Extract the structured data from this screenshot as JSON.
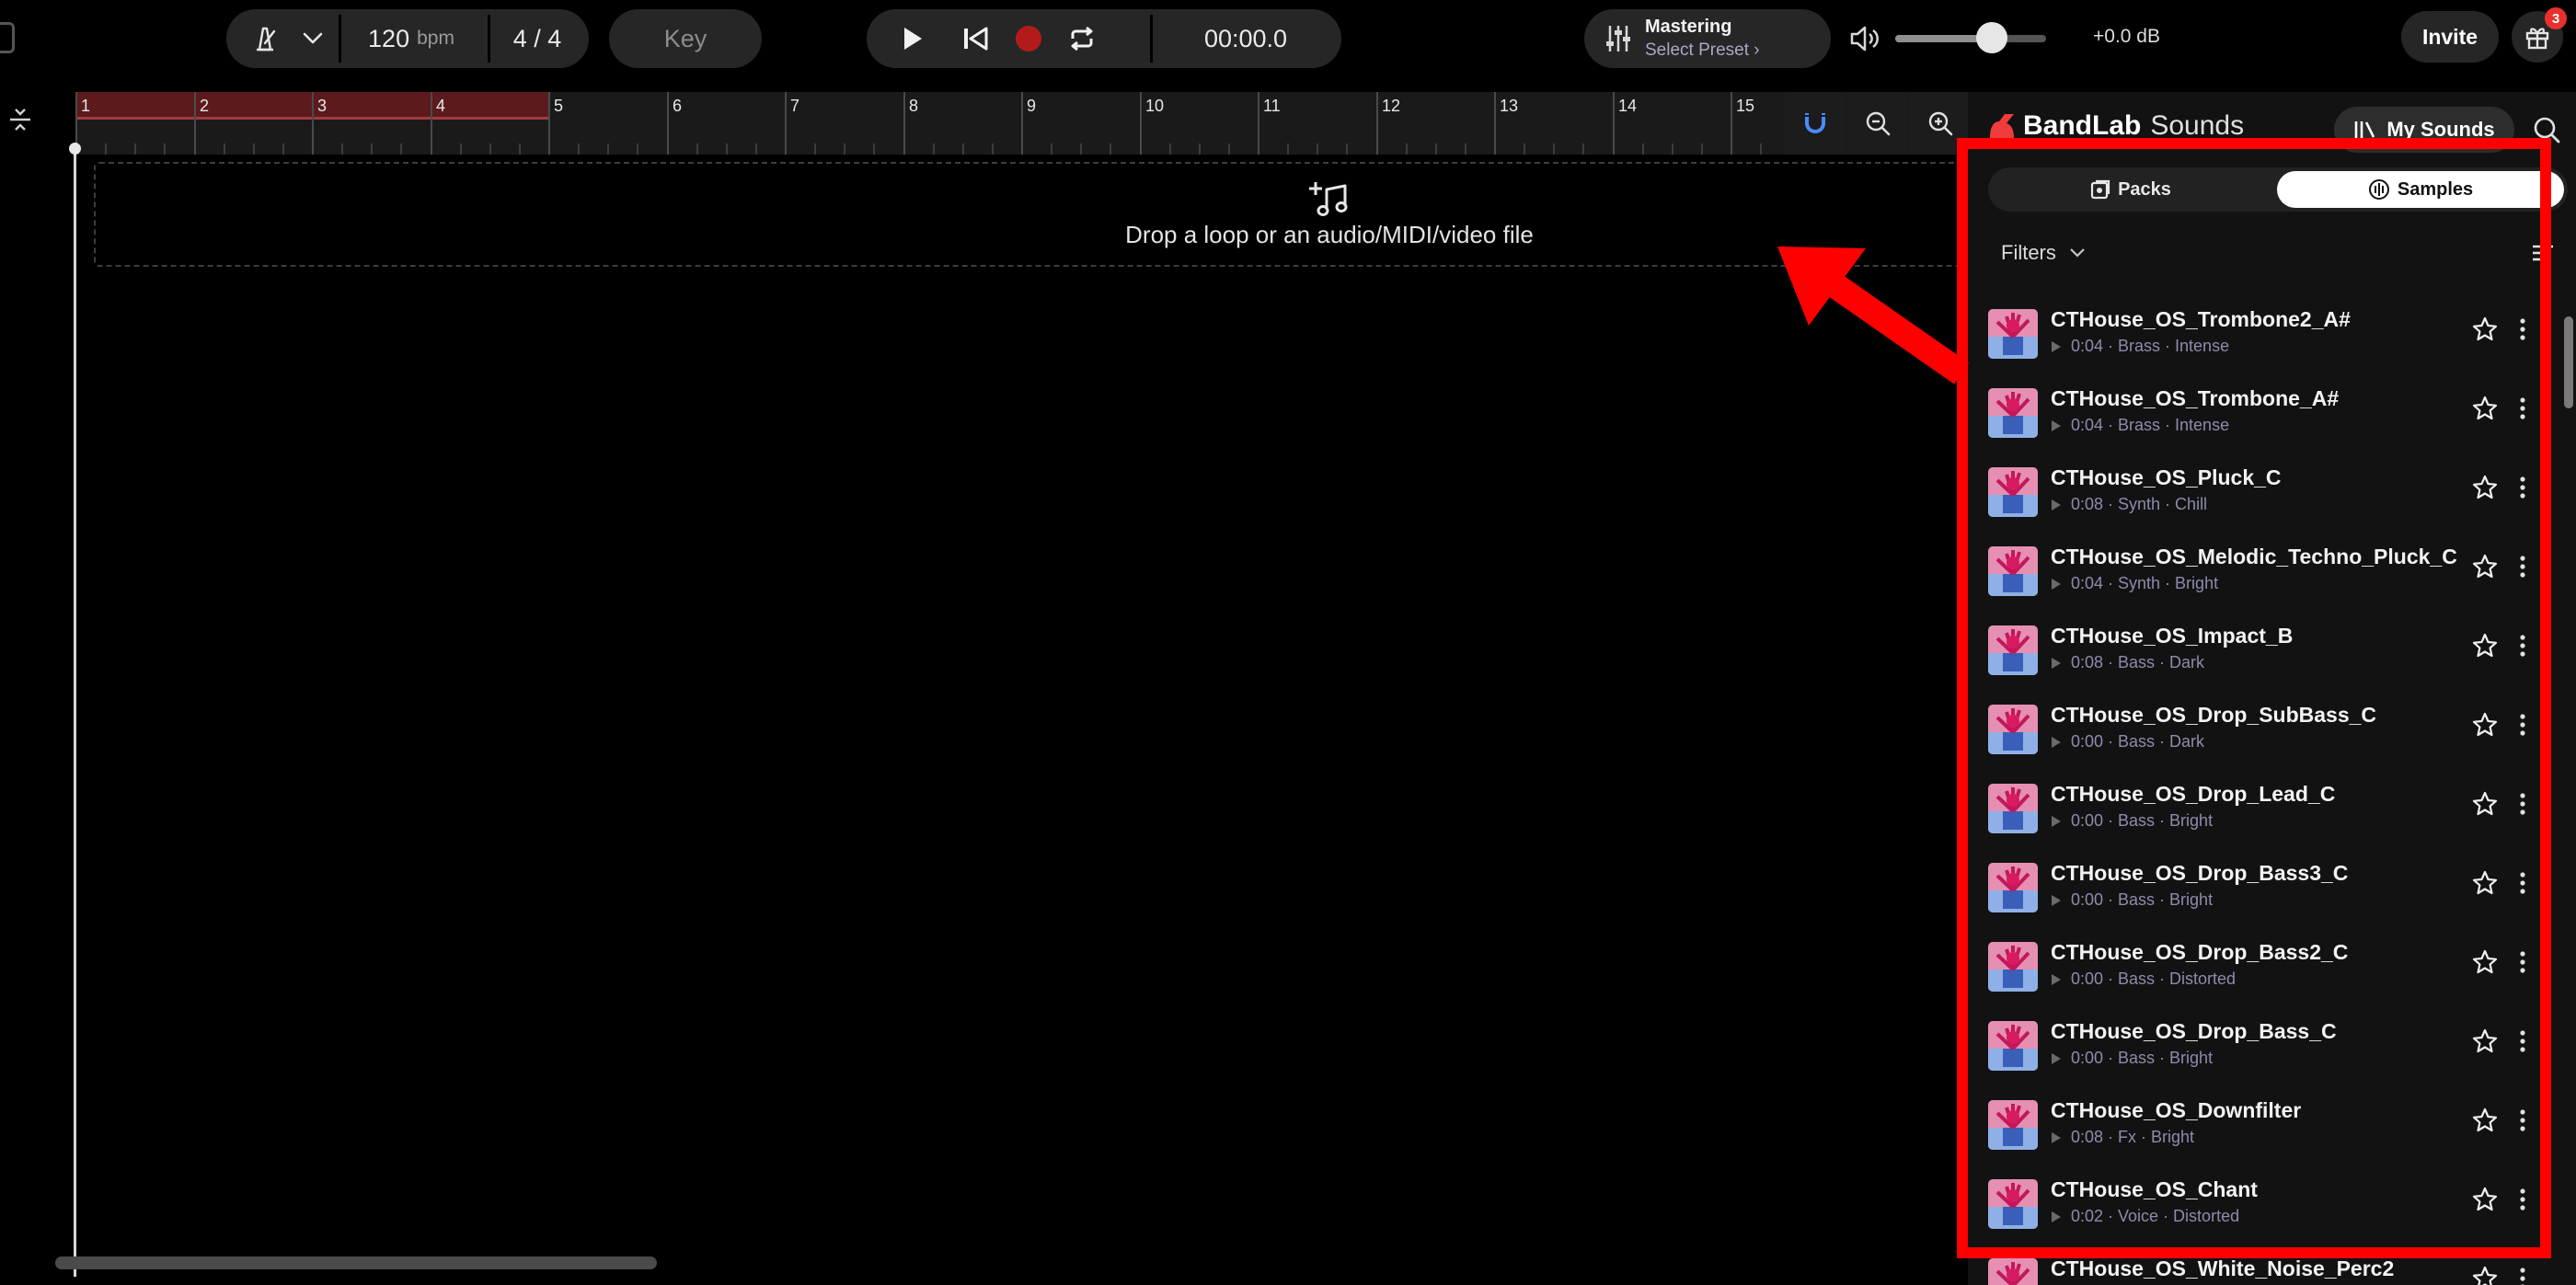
{
  "toolbar": {
    "tempo_value": "120",
    "tempo_unit": "bpm",
    "time_signature": "4 / 4",
    "key_label": "Key",
    "time_display": "00:00.0",
    "mastering_title": "Mastering",
    "mastering_preset": "Select Preset",
    "volume_db": "+0.0 dB",
    "volume_level": 0.62,
    "invite_label": "Invite",
    "gift_badge": "3"
  },
  "timeline": {
    "bars": [
      "1",
      "2",
      "3",
      "4",
      "5",
      "6",
      "7",
      "8",
      "9",
      "10",
      "11",
      "12",
      "13",
      "14",
      "15"
    ],
    "loop_bars": [
      1,
      4
    ],
    "drop_text": "Drop a loop or an audio/MIDI/video file"
  },
  "panel": {
    "brand": "BandLab",
    "brand_suffix": "Sounds",
    "my_sounds_label": "My Sounds",
    "tabs": [
      {
        "label": "Packs",
        "active": false
      },
      {
        "label": "Samples",
        "active": true
      }
    ],
    "filters_label": "Filters",
    "items": [
      {
        "title": "CTHouse_OS_Trombone2_A#",
        "meta": "0:04 · Brass · Intense"
      },
      {
        "title": "CTHouse_OS_Trombone_A#",
        "meta": "0:04 · Brass · Intense"
      },
      {
        "title": "CTHouse_OS_Pluck_C",
        "meta": "0:08 · Synth · Chill"
      },
      {
        "title": "CTHouse_OS_Melodic_Techno_Pluck_C",
        "meta": "0:04 · Synth · Bright"
      },
      {
        "title": "CTHouse_OS_Impact_B",
        "meta": "0:08 · Bass · Dark"
      },
      {
        "title": "CTHouse_OS_Drop_SubBass_C",
        "meta": "0:00 · Bass · Dark"
      },
      {
        "title": "CTHouse_OS_Drop_Lead_C",
        "meta": "0:00 · Bass · Bright"
      },
      {
        "title": "CTHouse_OS_Drop_Bass3_C",
        "meta": "0:00 · Bass · Bright"
      },
      {
        "title": "CTHouse_OS_Drop_Bass2_C",
        "meta": "0:00 · Bass · Distorted"
      },
      {
        "title": "CTHouse_OS_Drop_Bass_C",
        "meta": "0:00 · Bass · Bright"
      },
      {
        "title": "CTHouse_OS_Downfilter",
        "meta": "0:08 · Fx · Bright"
      },
      {
        "title": "CTHouse_OS_Chant",
        "meta": "0:02 · Voice · Distorted"
      },
      {
        "title": "CTHouse_OS_White_Noise_Perc2",
        "meta": ""
      }
    ]
  },
  "colors": {
    "accent_red": "#ff0000",
    "record_red": "#b31b1b",
    "loop_region": "#5c1a1d",
    "magnet_blue": "#4a8cff"
  }
}
